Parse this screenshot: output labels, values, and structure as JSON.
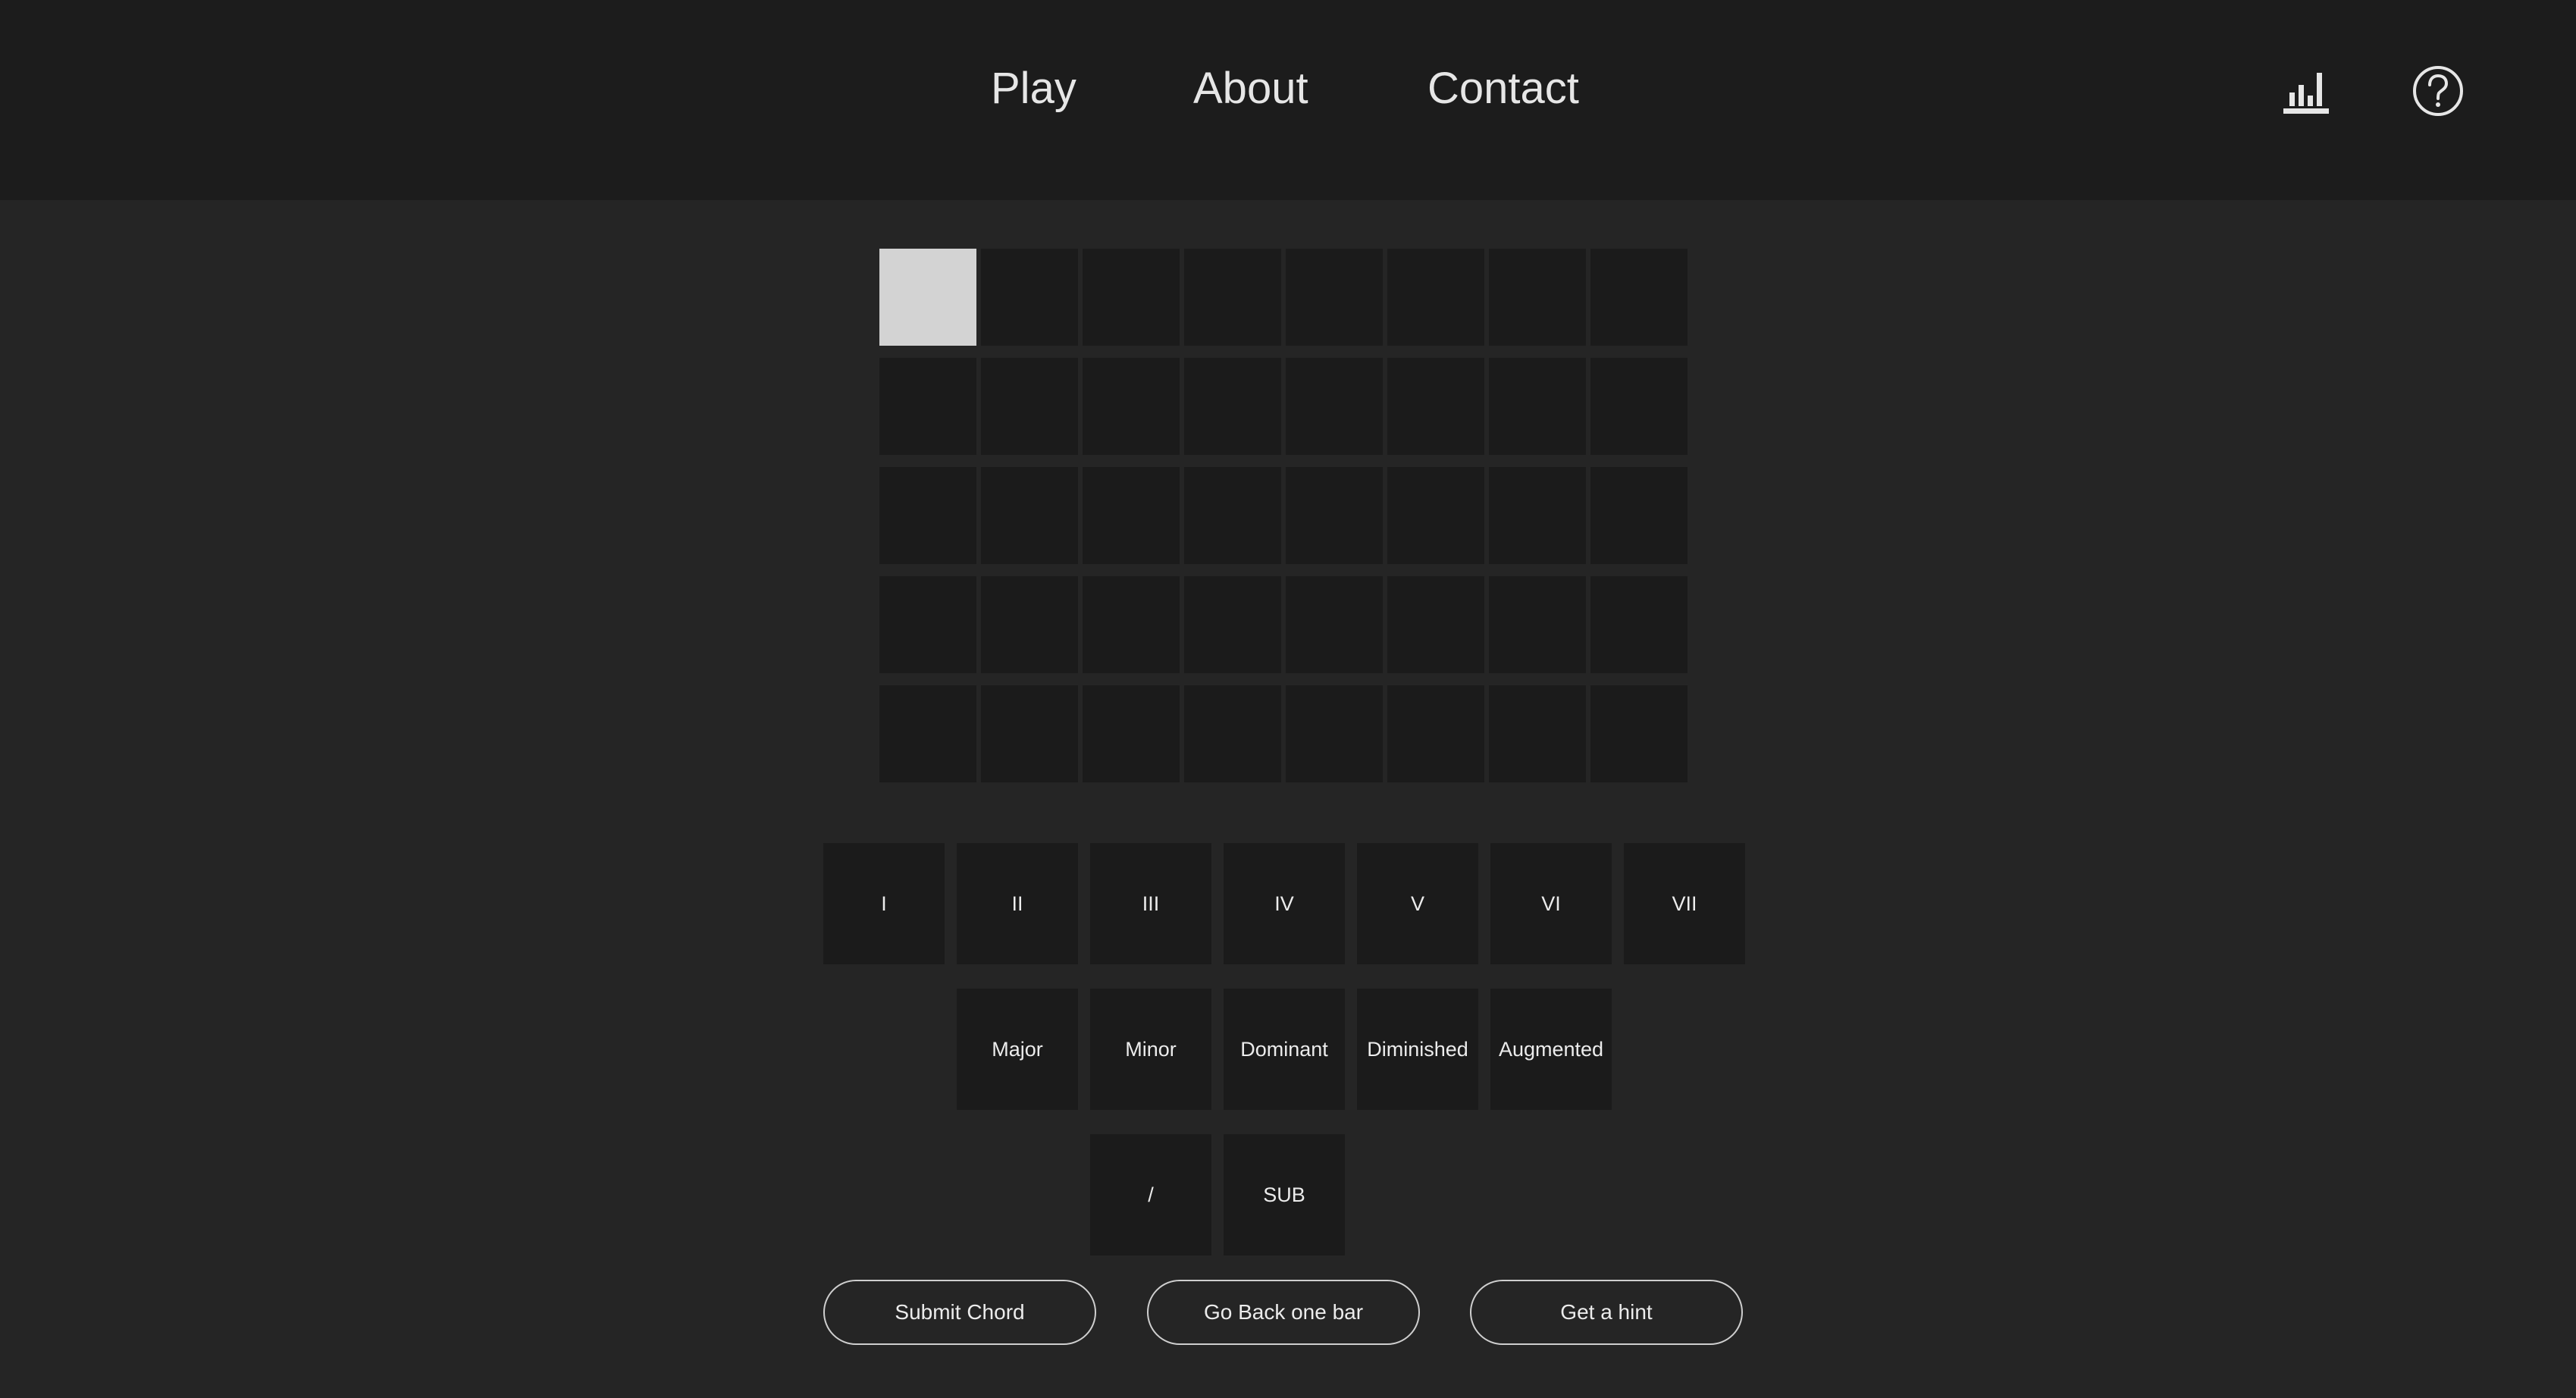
{
  "nav": {
    "play": "Play",
    "about": "About",
    "contact": "Contact"
  },
  "icons": {
    "stats": "bar-chart-icon",
    "help": "help-circle-icon"
  },
  "board": {
    "rows": 5,
    "columns": 8,
    "active_cell": {
      "row": 1,
      "column": 1
    }
  },
  "numerals": [
    "I",
    "II",
    "III",
    "IV",
    "V",
    "VI",
    "VII"
  ],
  "qualities": [
    "Major",
    "Minor",
    "Dominant",
    "Diminished",
    "Augmented"
  ],
  "modifiers": [
    "/",
    "SUB"
  ],
  "actions": {
    "submit": "Submit Chord",
    "back": "Go Back one bar",
    "hint": "Get a hint"
  },
  "colors": {
    "header_bg": "#1c1c1c",
    "page_bg": "#252525",
    "tile_bg": "#1b1b1b",
    "active_tile": "#d3d3d3",
    "text": "#ececec"
  }
}
